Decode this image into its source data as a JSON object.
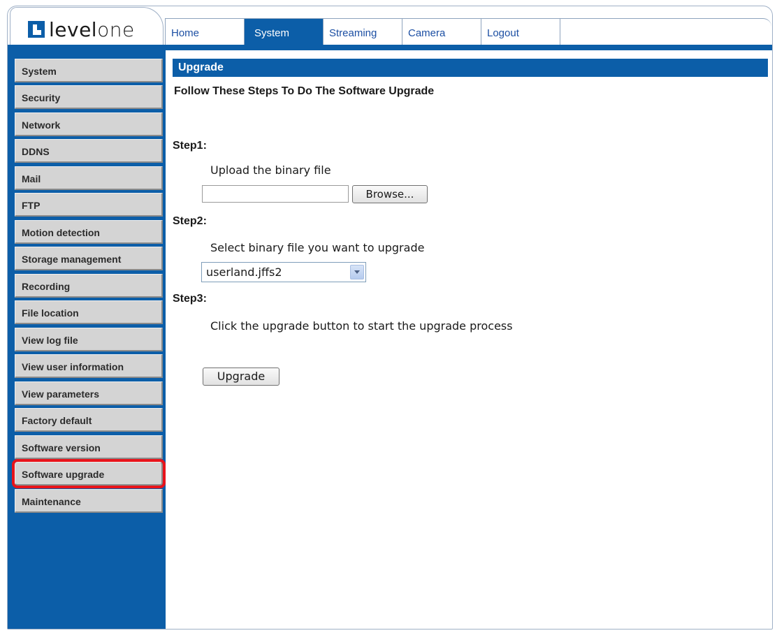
{
  "brand": {
    "logo_text": "level",
    "logo_text_suffix": "one"
  },
  "topnav": {
    "tabs": [
      {
        "label": "Home"
      },
      {
        "label": "System",
        "active": true
      },
      {
        "label": "Streaming"
      },
      {
        "label": "Camera"
      },
      {
        "label": "Logout"
      }
    ]
  },
  "sidebar": {
    "items": [
      {
        "label": "System"
      },
      {
        "label": "Security"
      },
      {
        "label": "Network"
      },
      {
        "label": "DDNS"
      },
      {
        "label": "Mail"
      },
      {
        "label": "FTP"
      },
      {
        "label": "Motion detection"
      },
      {
        "label": "Storage management"
      },
      {
        "label": "Recording"
      },
      {
        "label": "File location"
      },
      {
        "label": "View log file"
      },
      {
        "label": "View user information"
      },
      {
        "label": "View parameters"
      },
      {
        "label": "Factory default"
      },
      {
        "label": "Software version"
      },
      {
        "label": "Software upgrade",
        "selected": true
      },
      {
        "label": "Maintenance"
      }
    ]
  },
  "main": {
    "header": "Upgrade",
    "subtitle": "Follow These Steps To Do The Software Upgrade",
    "step1": {
      "title": "Step1:",
      "desc": "Upload the binary file",
      "file_value": "",
      "browse_label": "Browse..."
    },
    "step2": {
      "title": "Step2:",
      "desc": "Select binary file you want to upgrade",
      "selected_option": "userland.jffs2"
    },
    "step3": {
      "title": "Step3:",
      "desc": "Click the upgrade button to start the upgrade process",
      "button_label": "Upgrade"
    }
  },
  "colors": {
    "accent": "#0c5ea8",
    "highlight": "#e8141b",
    "sidebar_item": "#d4d4d4"
  },
  "icons": {
    "select_arrow": "chevron-down-icon"
  }
}
